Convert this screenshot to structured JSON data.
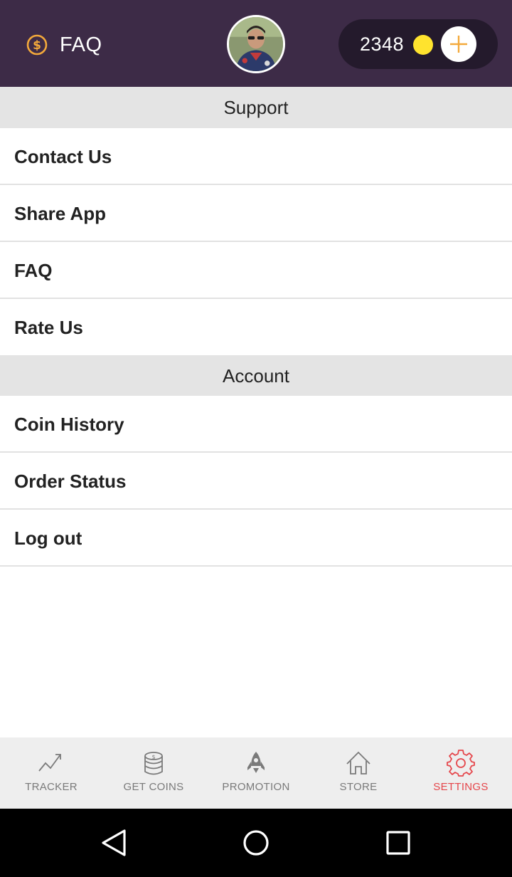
{
  "header": {
    "title": "FAQ",
    "left_icon": "coin-outline-icon",
    "avatar": "profile-avatar",
    "coin_balance": "2348",
    "coin_icon": "coin-dot-icon",
    "add_icon": "plus-icon",
    "colors": {
      "bar": "#3d2b47",
      "pill": "#241a2c",
      "coin": "#ffe32e",
      "accent": "#f3a93b"
    }
  },
  "sections": [
    {
      "title": "Support",
      "items": [
        "Contact Us",
        "Share App",
        "FAQ",
        "Rate Us"
      ]
    },
    {
      "title": "Account",
      "items": [
        "Coin History",
        "Order Status",
        "Log out"
      ]
    }
  ],
  "tabs": [
    {
      "label": "TRACKER",
      "icon": "trend-line-icon",
      "active": false
    },
    {
      "label": "GET COINS",
      "icon": "coin-stack-icon",
      "active": false
    },
    {
      "label": "PROMOTION",
      "icon": "rocket-icon",
      "active": false
    },
    {
      "label": "STORE",
      "icon": "home-icon",
      "active": false
    },
    {
      "label": "SETTINGS",
      "icon": "gear-icon",
      "active": true
    }
  ],
  "tab_colors": {
    "active": "#e5464b",
    "inactive": "#7a7a7a"
  },
  "system_nav": [
    "back-icon",
    "home-circle-icon",
    "recents-icon"
  ]
}
